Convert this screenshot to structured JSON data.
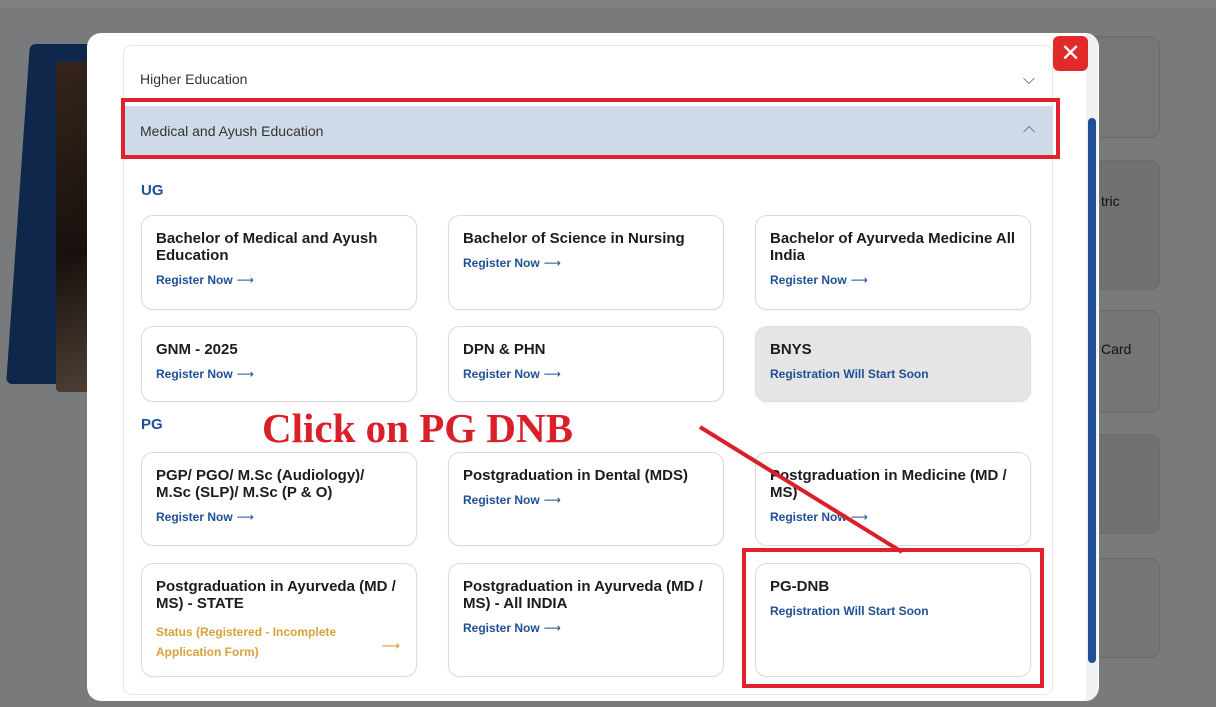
{
  "background": {
    "card_labels": [
      "tric",
      "Card"
    ]
  },
  "modal": {
    "close_label": "✕",
    "accordion": {
      "higher": {
        "label": "Higher Education",
        "chevron": "chevron-down-icon"
      },
      "medical": {
        "label": "Medical and Ayush Education",
        "chevron": "chevron-up-icon"
      }
    },
    "ug": {
      "label": "UG",
      "courses": [
        {
          "title": "Bachelor of Medical and Ayush Education",
          "link": "Register Now"
        },
        {
          "title": "Bachelor of Science in Nursing",
          "link": "Register Now"
        },
        {
          "title": "Bachelor of Ayurveda Medicine All India",
          "link": "Register Now"
        },
        {
          "title": "GNM - 2025",
          "link": "Register Now"
        },
        {
          "title": "DPN & PHN",
          "link": "Register Now"
        },
        {
          "title": "BNYS",
          "link": "Registration Will Start Soon"
        }
      ]
    },
    "pg": {
      "label": "PG",
      "courses": [
        {
          "title": "PGP/ PGO/ M.Sc (Audiology)/ M.Sc (SLP)/ M.Sc (P & O)",
          "link": "Register Now"
        },
        {
          "title": "Postgraduation in Dental (MDS)",
          "link": "Register Now"
        },
        {
          "title": "Postgraduation in Medicine (MD / MS)",
          "link": "Register Now"
        },
        {
          "title": "Postgraduation in Ayurveda (MD / MS) - STATE",
          "status": "Status (Registered - Incomplete Application Form)"
        },
        {
          "title": "Postgraduation in Ayurveda (MD / MS) - All INDIA",
          "link": "Register Now"
        },
        {
          "title": "PG-DNB",
          "link": "Registration Will Start Soon"
        }
      ]
    }
  },
  "annotation": {
    "text": "Click on PG DNB",
    "color": "#d91f2a"
  },
  "colors": {
    "primary": "#1f4f95",
    "highlight_row": "#cfdae8",
    "status": "#d9a13a",
    "close": "#e12b2b"
  }
}
